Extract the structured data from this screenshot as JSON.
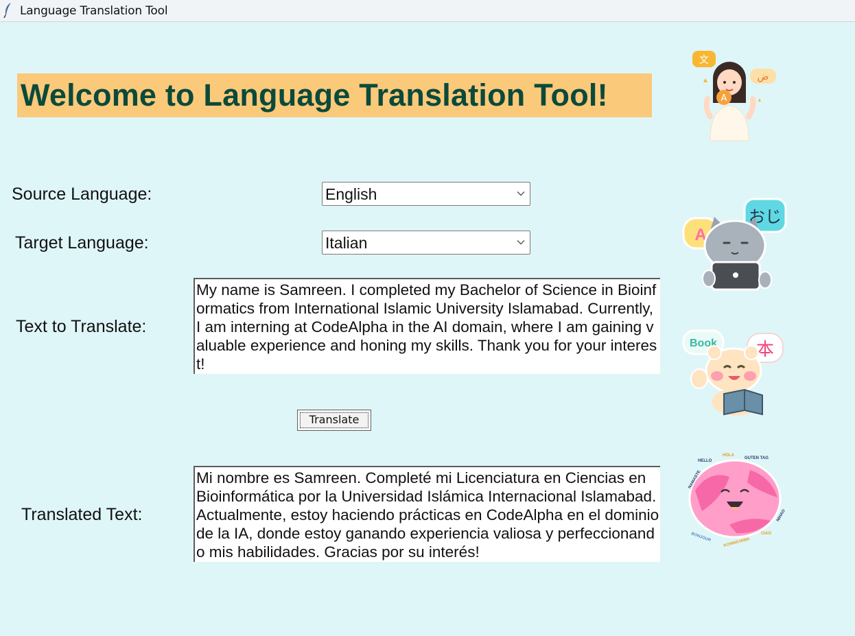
{
  "window": {
    "title": "Language Translation Tool"
  },
  "header": {
    "welcome": "Welcome to Language Translation Tool!"
  },
  "form": {
    "source_label": "Source Language:",
    "source_value": "English",
    "target_label": "Target Language:",
    "target_value": "Italian",
    "text_label": "Text to Translate:",
    "text_value": "My name is Samreen. I completed my Bachelor of Science in Bioinformatics from International Islamic University Islamabad. Currently, I am interning at CodeAlpha in the AI domain, where I am gaining valuable experience and honing my skills. Thank you for your interest!",
    "translate_button": "Translate",
    "translated_label": "Translated Text:",
    "translated_value": "Mi nombre es Samreen. Completé mi Licenciatura en Ciencias en Bioinformática por la Universidad Islámica Internacional Islamabad. Actualmente, estoy haciendo prácticas en CodeAlpha en el dominio de la IA, donde estoy ganando experiencia valiosa y perfeccionando mis habilidades. Gracias por su interés!"
  },
  "stickers": {
    "cat_bubble_left": "A",
    "cat_bubble_right": "おじ",
    "bear_bubble_left": "Book",
    "bear_bubble_right": "本",
    "girl_bubble_left": "文",
    "girl_bubble_right": "ض",
    "girl_bubble_center": "A",
    "globe_words": [
      "HELLO",
      "HOLA",
      "GUTEN TAG",
      "NAMASTE",
      "NIHAO",
      "CIAO",
      "BONJOUR",
      "KONNICHIWA"
    ]
  },
  "colors": {
    "background": "#dff6f8",
    "heading_bg": "#fbc97a",
    "heading_text": "#0b4a3a"
  },
  "icons": {
    "app": "feather-icon",
    "dropdown": "chevron-down-icon"
  }
}
